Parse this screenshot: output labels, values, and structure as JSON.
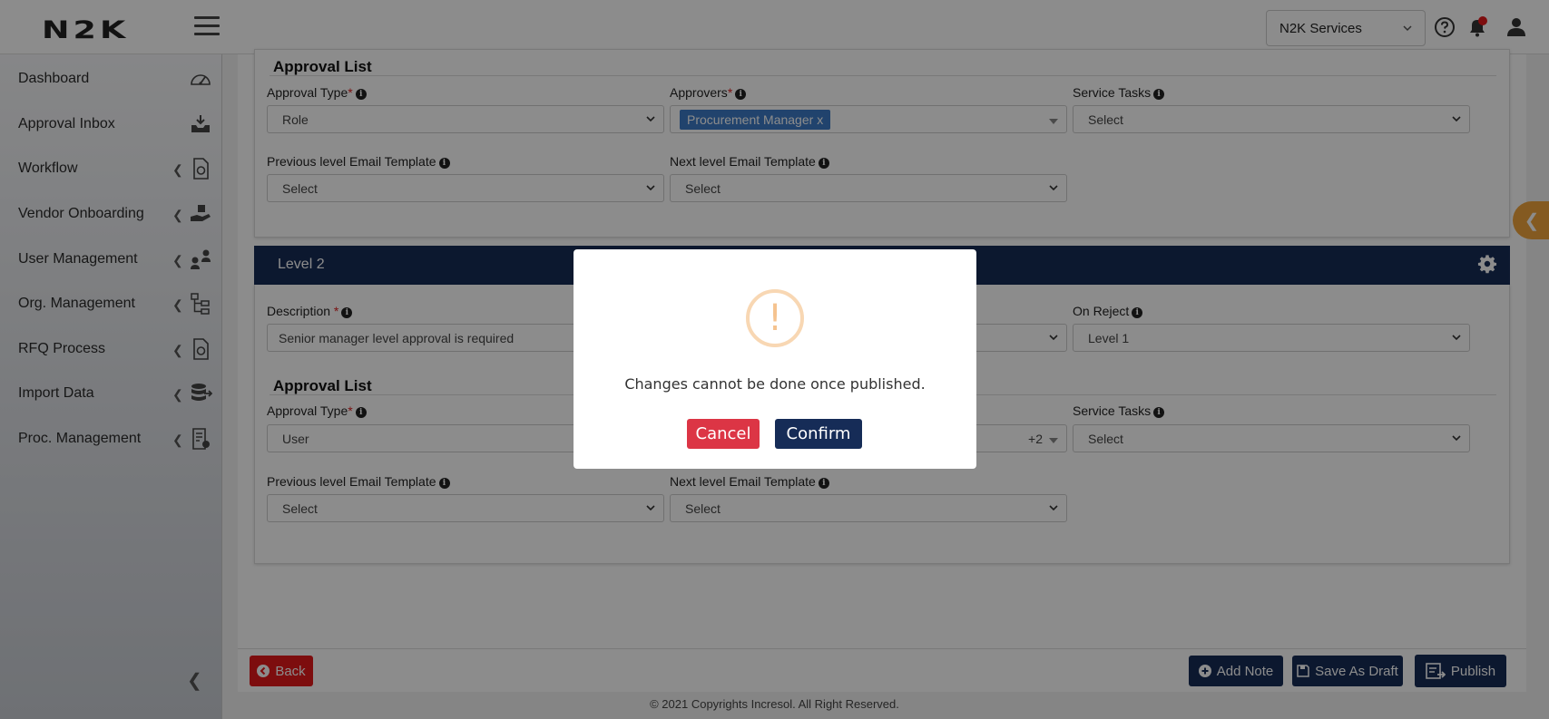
{
  "header": {
    "logo": "N2K",
    "service_select": "N2K Services",
    "icons": [
      "menu-icon",
      "help-icon",
      "bell-icon",
      "user-icon"
    ]
  },
  "sidebar": {
    "items": [
      {
        "label": "Dashboard",
        "icon": "speedometer-icon",
        "has_children": false
      },
      {
        "label": "Approval Inbox",
        "icon": "inbox-icon",
        "has_children": false
      },
      {
        "label": "Workflow",
        "icon": "workflow-doc-icon",
        "has_children": true
      },
      {
        "label": "Vendor Onboarding",
        "icon": "hand-box-icon",
        "has_children": true
      },
      {
        "label": "User Management",
        "icon": "user-cycle-icon",
        "has_children": true
      },
      {
        "label": "Org. Management",
        "icon": "org-tree-icon",
        "has_children": true
      },
      {
        "label": "RFQ Process",
        "icon": "rfq-doc-icon",
        "has_children": true
      },
      {
        "label": "Import Data",
        "icon": "database-import-icon",
        "has_children": true
      },
      {
        "label": "Proc. Management",
        "icon": "proc-doc-icon",
        "has_children": true
      }
    ]
  },
  "level1": {
    "approval_list_title": "Approval List",
    "approval_type_label": "Approval Type",
    "approval_type_value": "Role",
    "approvers_label": "Approvers",
    "approver_tag": "Procurement Manager",
    "approver_tag_remove": "x",
    "service_tasks_label": "Service Tasks",
    "service_tasks_value": "Select",
    "prev_email_label": "Previous level Email Template",
    "prev_email_value": "Select",
    "next_email_label": "Next level Email Template",
    "next_email_value": "Select"
  },
  "level2": {
    "title": "Level 2",
    "description_label": "Description",
    "description_value": "Senior manager level approval is required",
    "on_reject_label": "On Reject",
    "on_reject_value": "Level 1",
    "approval_list_title": "Approval List",
    "approval_type_label": "Approval Type",
    "approval_type_value": "User",
    "approvers_more": "+2",
    "service_tasks_label": "Service Tasks",
    "service_tasks_value": "Select",
    "prev_email_label": "Previous level Email Template",
    "prev_email_value": "Select",
    "next_email_label": "Next level Email Template",
    "next_email_value": "Select"
  },
  "footer": {
    "back": "Back",
    "add_note": "Add Note",
    "save_draft": "Save As Draft",
    "publish": "Publish",
    "copyright": "© 2021 Copyrights Incresol. All Right Reserved."
  },
  "modal": {
    "icon": "!",
    "message": "Changes cannot be done once published.",
    "cancel": "Cancel",
    "confirm": "Confirm"
  },
  "colors": {
    "navy": "#162c57",
    "danger": "#dc3545",
    "back_red": "#e3191b",
    "tag_blue": "#3c7bc6",
    "orange": "#f0a53c"
  }
}
